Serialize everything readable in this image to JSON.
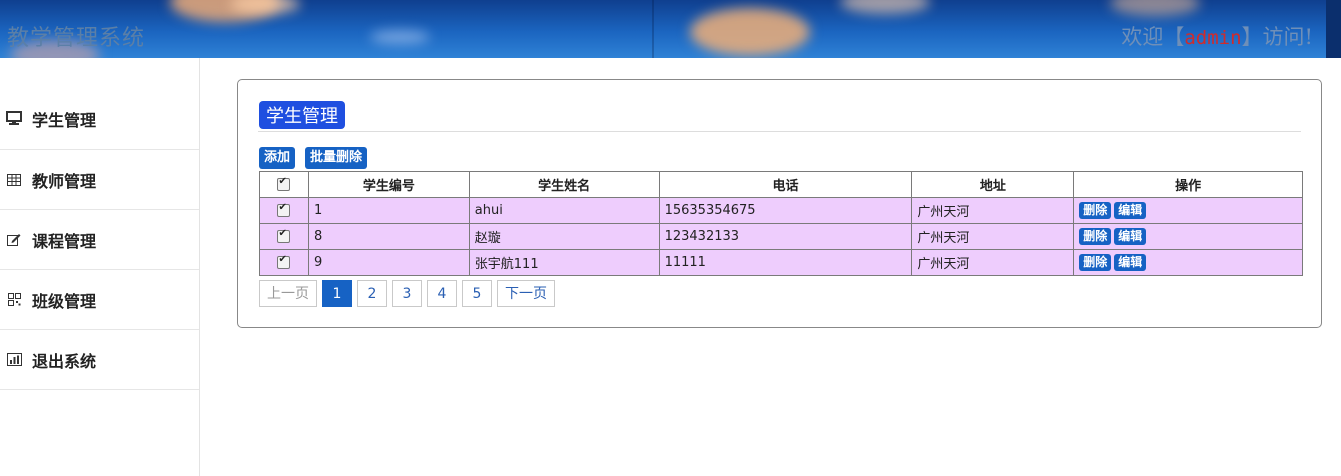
{
  "header": {
    "site_title": "教学管理系统",
    "welcome_prefix": "欢迎【",
    "username": "admin",
    "welcome_suffix": "】访问!"
  },
  "sidebar": {
    "items": [
      {
        "label": "学生管理",
        "icon": "monitor-icon"
      },
      {
        "label": "教师管理",
        "icon": "table-icon"
      },
      {
        "label": "课程管理",
        "icon": "edit-icon"
      },
      {
        "label": "班级管理",
        "icon": "grid-icon"
      },
      {
        "label": "退出系统",
        "icon": "bar-chart-icon"
      }
    ]
  },
  "panel": {
    "title": "学生管理",
    "add_label": "添加",
    "batch_delete_label": "批量删除"
  },
  "table": {
    "headers": [
      "学生编号",
      "学生姓名",
      "电话",
      "地址",
      "操作"
    ],
    "rows": [
      {
        "id": "1",
        "name": "ahui",
        "phone": "15635354675",
        "address": "广州天河"
      },
      {
        "id": "8",
        "name": "赵璇",
        "phone": "123432133",
        "address": "广州天河"
      },
      {
        "id": "9",
        "name": "张宇航111",
        "phone": "11111",
        "address": "广州天河"
      }
    ],
    "delete_label": "删除",
    "edit_label": "编辑"
  },
  "pagination": {
    "prev_label": "上一页",
    "pages": [
      "1",
      "2",
      "3",
      "4",
      "5"
    ],
    "current": "1",
    "next_label": "下一页"
  },
  "colors": {
    "accent": "#1662c4",
    "title_badge": "#1f4fe0",
    "row_background": "#eecdfd",
    "username": "#d12b2b"
  }
}
